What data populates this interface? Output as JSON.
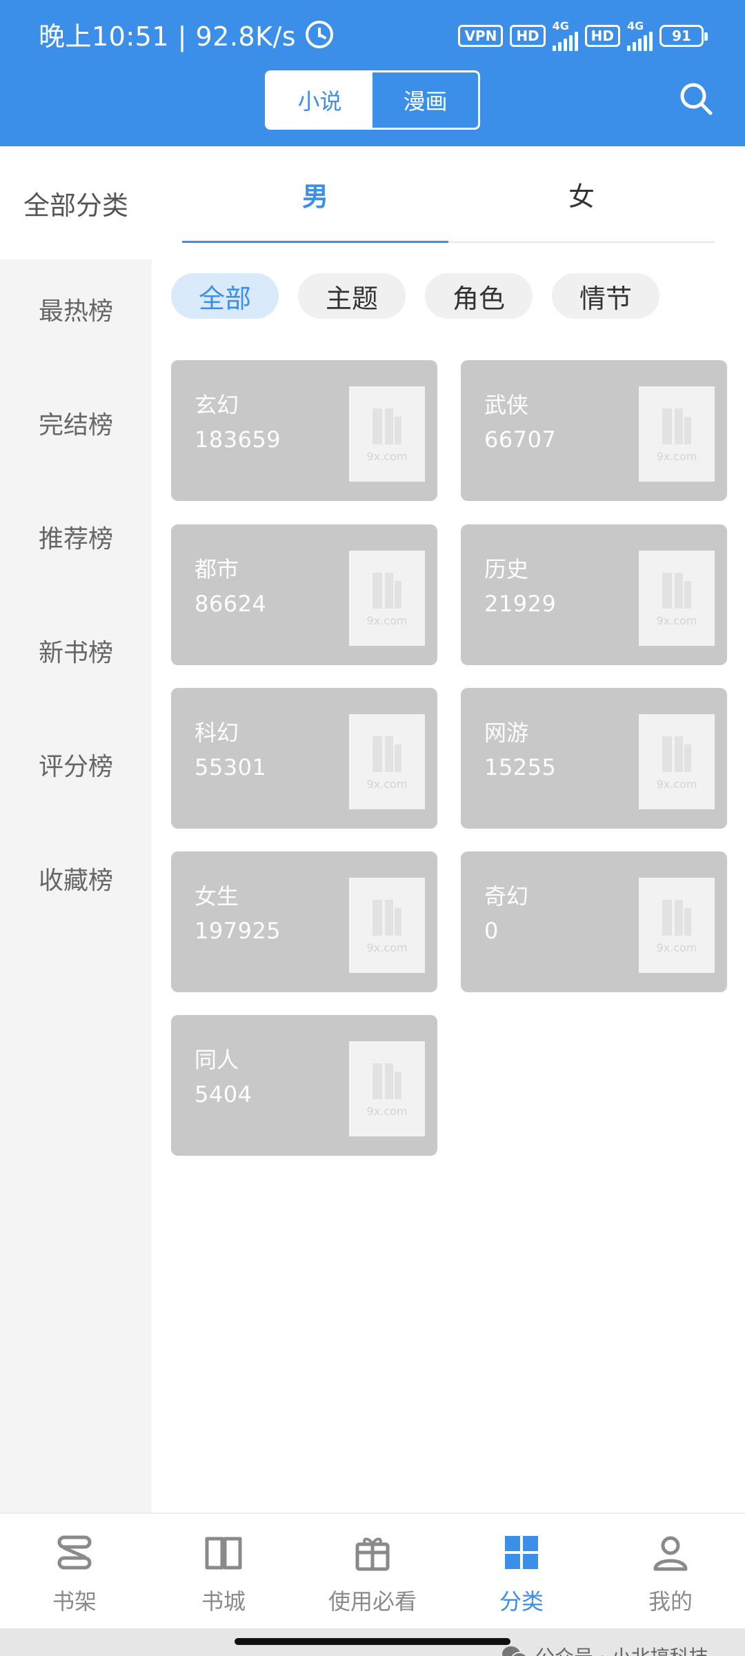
{
  "status_bar": {
    "time_speed": "晚上10:51 | 92.8K/s",
    "vpn": "VPN",
    "hd": "HD",
    "net": "4G",
    "battery": "91"
  },
  "header": {
    "tabs": [
      {
        "label": "小说",
        "active": true
      },
      {
        "label": "漫画",
        "active": false
      }
    ],
    "search_icon": "search-icon"
  },
  "sidebar": {
    "all_label": "全部分类",
    "items": [
      "最热榜",
      "完结榜",
      "推荐榜",
      "新书榜",
      "评分榜",
      "收藏榜"
    ]
  },
  "gender_tabs": [
    {
      "label": "男",
      "active": true
    },
    {
      "label": "女",
      "active": false
    }
  ],
  "filter_chips": [
    {
      "label": "全部",
      "active": true
    },
    {
      "label": "主题",
      "active": false
    },
    {
      "label": "角色",
      "active": false
    },
    {
      "label": "情节",
      "active": false
    }
  ],
  "categories": [
    {
      "name": "玄幻",
      "count": "183659",
      "thumb_text": "9x.com"
    },
    {
      "name": "武侠",
      "count": "66707",
      "thumb_text": "9x.com"
    },
    {
      "name": "都市",
      "count": "86624",
      "thumb_text": "9x.com"
    },
    {
      "name": "历史",
      "count": "21929",
      "thumb_text": "9x.com"
    },
    {
      "name": "科幻",
      "count": "55301",
      "thumb_text": "9x.com"
    },
    {
      "name": "网游",
      "count": "15255",
      "thumb_text": "9x.com"
    },
    {
      "name": "女生",
      "count": "197925",
      "thumb_text": "9x.com"
    },
    {
      "name": "奇幻",
      "count": "0",
      "thumb_text": "9x.com"
    },
    {
      "name": "同人",
      "count": "5404",
      "thumb_text": "9x.com"
    }
  ],
  "bottom_nav": [
    {
      "label": "书架",
      "icon": "bookshelf-icon",
      "active": false
    },
    {
      "label": "书城",
      "icon": "open-book-icon",
      "active": false
    },
    {
      "label": "使用必看",
      "icon": "gift-icon",
      "active": false
    },
    {
      "label": "分类",
      "icon": "grid-icon",
      "active": true
    },
    {
      "label": "我的",
      "icon": "user-icon",
      "active": false
    }
  ],
  "watermark": "公众号 · 小北搞科技",
  "colors": {
    "accent": "#3b8fe8",
    "card": "#c8c8c8",
    "sidebar_bg": "#f4f4f5"
  }
}
